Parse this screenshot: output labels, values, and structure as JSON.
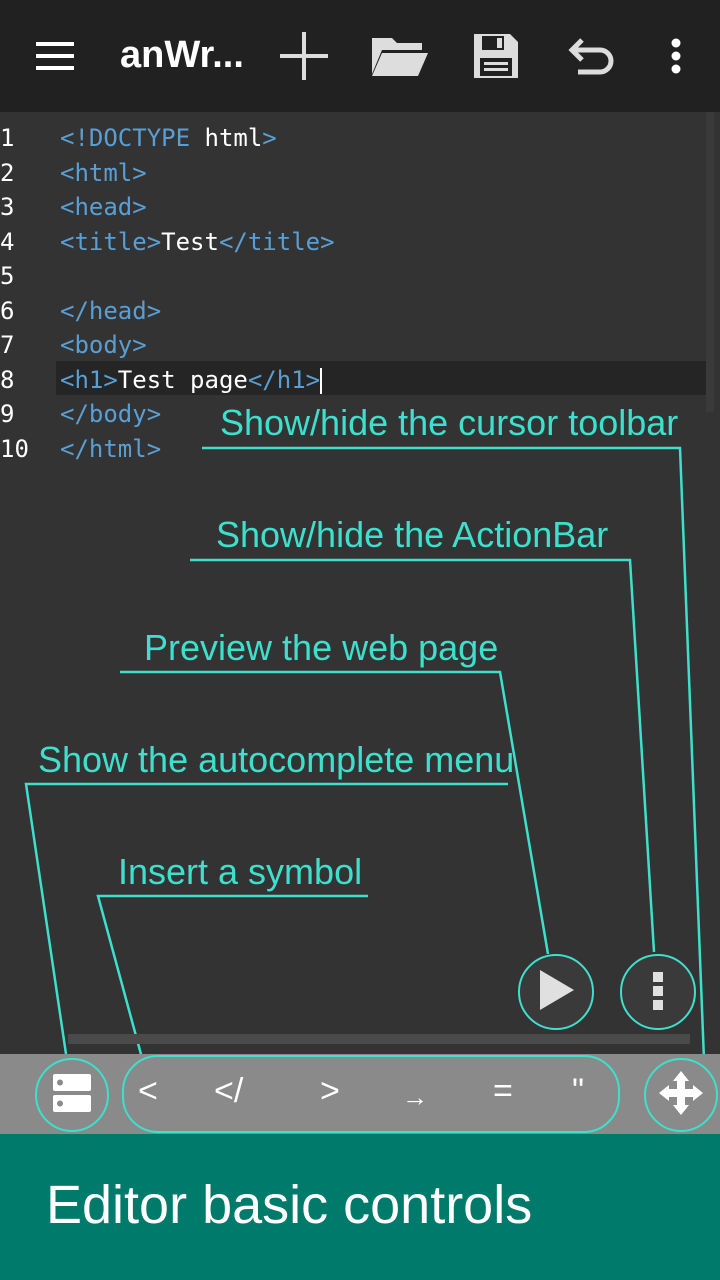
{
  "actionbar": {
    "title": "anWr...",
    "icons": [
      "menu-icon",
      "add-icon",
      "folder-icon",
      "save-icon",
      "undo-icon",
      "more-vert-icon"
    ]
  },
  "editor": {
    "line_numbers": [
      "1",
      "2",
      "3",
      "4",
      "5",
      "6",
      "7",
      "8",
      "9",
      "10"
    ],
    "lines": [
      [
        {
          "t": "tag",
          "v": "<!DOCTYPE "
        },
        {
          "t": "txt",
          "v": "html"
        },
        {
          "t": "tag",
          "v": ">"
        }
      ],
      [
        {
          "t": "tag",
          "v": "<html>"
        }
      ],
      [
        {
          "t": "tag",
          "v": "<head>"
        }
      ],
      [
        {
          "t": "tag",
          "v": "<title>"
        },
        {
          "t": "txt",
          "v": "Test"
        },
        {
          "t": "tag",
          "v": "</title>"
        }
      ],
      [],
      [
        {
          "t": "tag",
          "v": "</head>"
        }
      ],
      [
        {
          "t": "tag",
          "v": "<body>"
        }
      ],
      [
        {
          "t": "tag",
          "v": "<h1>"
        },
        {
          "t": "txt",
          "v": "Test page"
        },
        {
          "t": "tag",
          "v": "</h1>"
        }
      ],
      [
        {
          "t": "tag",
          "v": "</body>"
        }
      ],
      [
        {
          "t": "tag",
          "v": "</html>"
        }
      ]
    ]
  },
  "callouts": {
    "cursor_toolbar": "Show/hide the cursor toolbar",
    "actionbar": "Show/hide the ActionBar",
    "preview": "Preview the web page",
    "autocomplete": "Show the autocomplete menu",
    "symbol": "Insert a symbol"
  },
  "symbols": [
    "<",
    "</",
    ">",
    "→",
    "=",
    "\""
  ],
  "footer": {
    "title": "Editor basic controls"
  },
  "colors": {
    "accent": "#3de0cc",
    "tag": "#5a9fd4",
    "footer": "#007a6a"
  }
}
